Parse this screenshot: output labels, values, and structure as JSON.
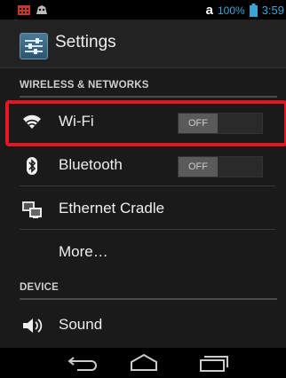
{
  "status_bar": {
    "carrier": "a",
    "battery_percent": "100%",
    "time": "3:59"
  },
  "action_bar": {
    "title": "Settings",
    "icon": "settings-app-icon"
  },
  "sections": {
    "wireless": "WIRELESS & NETWORKS",
    "device": "DEVICE"
  },
  "rows": {
    "wifi": {
      "label": "Wi-Fi",
      "toggle": "OFF",
      "icon": "wifi-icon"
    },
    "bluetooth": {
      "label": "Bluetooth",
      "toggle": "OFF",
      "icon": "bluetooth-icon"
    },
    "ethernet": {
      "label": "Ethernet Cradle",
      "icon": "ethernet-icon"
    },
    "more": {
      "label": "More…"
    },
    "sound": {
      "label": "Sound",
      "icon": "speaker-icon"
    }
  },
  "colors": {
    "accent": "#3aa6d8",
    "highlight": "#e8141f"
  }
}
